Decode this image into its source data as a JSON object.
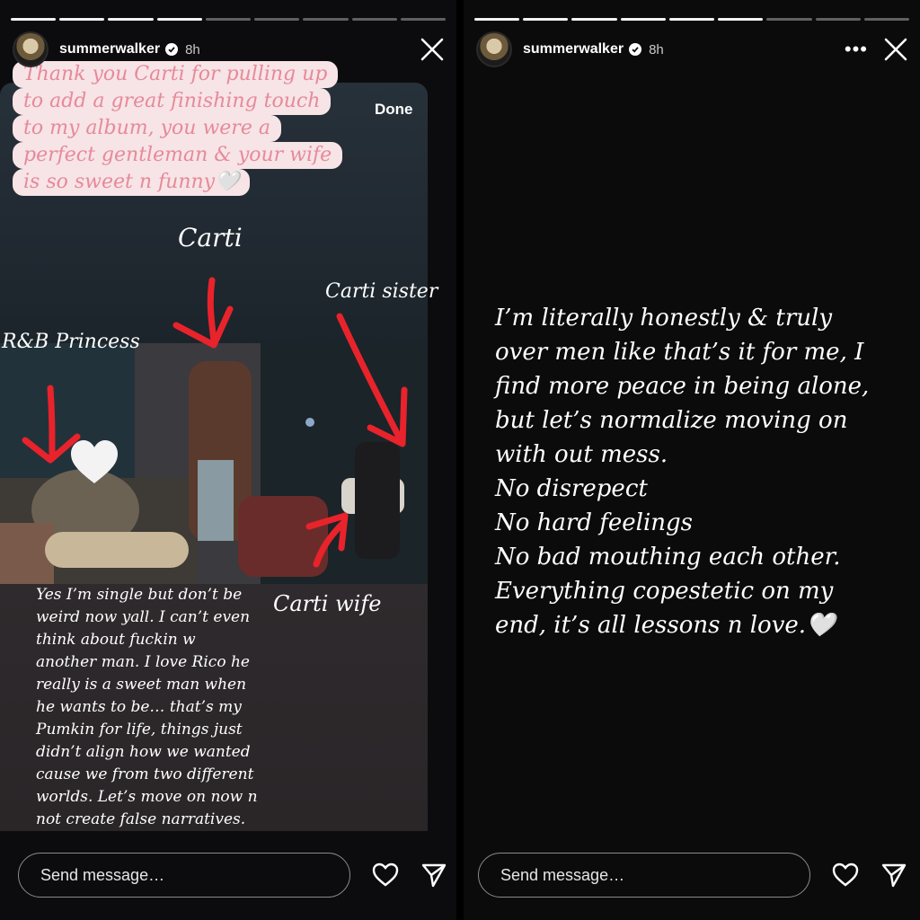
{
  "left_story": {
    "username": "summerwalker",
    "time": "8h",
    "progress": {
      "segments": 9,
      "completed": 4
    },
    "done_label": "Done",
    "pink_note": [
      "Thank you Carti for pulling up",
      "to add a great finishing touch",
      "to my album, you were a",
      "perfect gentleman & your wife",
      "is so sweet n funny🤍"
    ],
    "labels": {
      "carti": "Carti",
      "carti_sister": "Carti sister",
      "rnb_princess": "R&B Princess",
      "carti_wife": "Carti wife"
    },
    "caption": "Yes I’m single but don’t be\nweird now yall. I can’t even\nthink about fuckin w\nanother man. I love Rico he\nreally is a sweet man when\nhe wants to be… that’s my\nPumkin for life, things just\ndidn’t align how we wanted\ncause we from two different\nworlds. Let’s move on now n\nnot create false narratives.",
    "send_placeholder": "Send message…",
    "arrow_color": "#e8232b"
  },
  "right_story": {
    "username": "summerwalker",
    "time": "8h",
    "progress": {
      "segments": 9,
      "completed": 6
    },
    "text": "I’m literally honestly & truly\nover men like that’s it for me, I\nfind more peace in being alone,\nbut let’s normalize moving on\nwith out mess.\nNo disrepect\nNo hard feelings\nNo bad mouthing each other.\nEverything copestetic on my\nend, it’s all lessons n love.🤍",
    "send_placeholder": "Send message…"
  },
  "icons": {
    "verified": "verified-badge-icon",
    "more": "more-icon",
    "close": "close-icon",
    "like": "heart-icon",
    "share": "send-icon"
  }
}
